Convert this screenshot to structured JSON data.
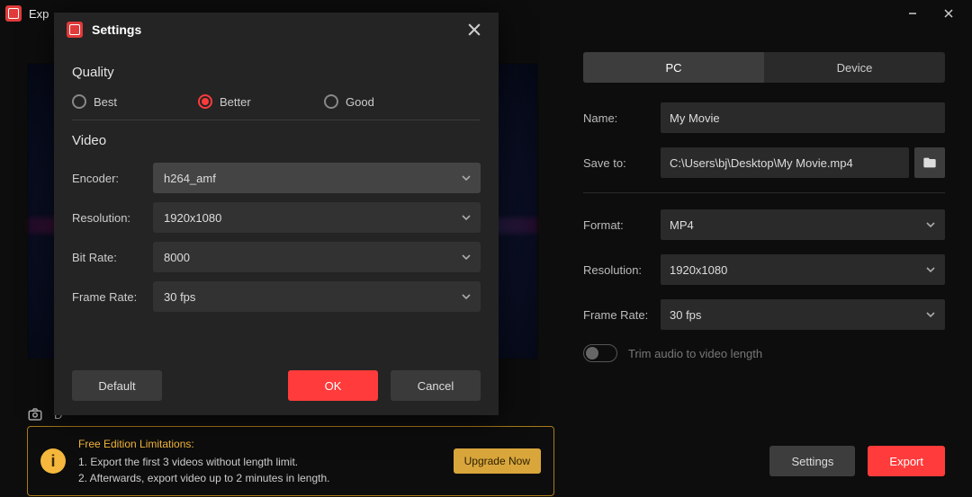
{
  "window": {
    "title": "Exp"
  },
  "export": {
    "tabs": {
      "pc": "PC",
      "device": "Device"
    },
    "name_label": "Name:",
    "name_value": "My Movie",
    "save_label": "Save to:",
    "save_value": "C:\\Users\\bj\\Desktop\\My Movie.mp4",
    "format_label": "Format:",
    "format_value": "MP4",
    "resolution_label": "Resolution:",
    "resolution_value": "1920x1080",
    "framerate_label": "Frame Rate:",
    "framerate_value": "30 fps",
    "trim_label": "Trim audio to video length"
  },
  "footer": {
    "lim_title": "Free Edition Limitations:",
    "lim_line1": "1. Export the first 3 videos without length limit.",
    "lim_line2": "2. Afterwards, export video up to 2 minutes in length.",
    "upgrade": "Upgrade Now",
    "settings": "Settings",
    "export": "Export"
  },
  "settings": {
    "title": "Settings",
    "quality_title": "Quality",
    "opt_best": "Best",
    "opt_better": "Better",
    "opt_good": "Good",
    "video_title": "Video",
    "encoder_label": "Encoder:",
    "encoder_value": "h264_amf",
    "resolution_label": "Resolution:",
    "resolution_value": "1920x1080",
    "bitrate_label": "Bit Rate:",
    "bitrate_value": "8000",
    "framerate_label": "Frame Rate:",
    "framerate_value": "30 fps",
    "default": "Default",
    "ok": "OK",
    "cancel": "Cancel"
  }
}
